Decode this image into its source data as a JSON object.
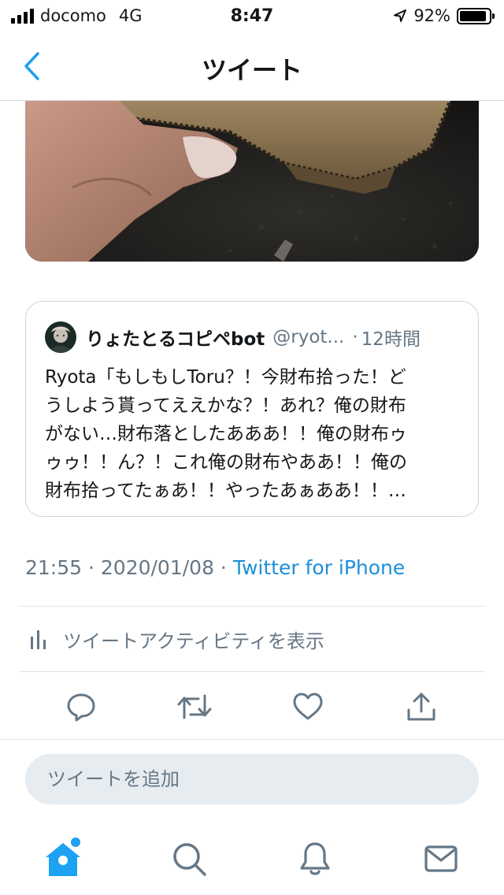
{
  "status_bar": {
    "carrier": "docomo",
    "network": "4G",
    "time": "8:47",
    "battery_text": "92%",
    "battery_level": 0.92
  },
  "nav": {
    "title": "ツイート",
    "back_icon": "chevron-left-icon"
  },
  "quoted_tweet": {
    "display_name": "りょたとるコピペbot",
    "handle": "@ryot...",
    "separator": "·",
    "time_ago": "12時間",
    "text_lines": [
      "Ryota「もしもしToru？！今財布拾った！ど",
      "うしよう貰ってええかな？！あれ？俺の財布",
      "がない…財布落としたあああ！！俺の財布ゥ",
      "ゥゥ！！ん？！これ俺の財布やああ！！俺の",
      "財布拾ってたぁあ！！やったあぁああ！！…"
    ]
  },
  "meta": {
    "timestamp": "21:55 · 2020/01/08 · ",
    "source": "Twitter for iPhone"
  },
  "activity": {
    "label": "ツイートアクティビティを表示",
    "icon": "bar-chart-icon"
  },
  "actions": [
    "reply-icon",
    "retweet-icon",
    "like-icon",
    "share-icon"
  ],
  "reply_input": {
    "placeholder": "ツイートを追加",
    "value": ""
  },
  "tab_bar": {
    "tabs": [
      "home-icon",
      "search-icon",
      "notifications-icon",
      "messages-icon"
    ],
    "active": "home-icon",
    "home_has_new_dot": true
  },
  "colors": {
    "accent": "#1da1f2",
    "link": "#1d8fd8",
    "secondary_text": "#657786",
    "icon_gray": "#657786",
    "divider": "#dfe3e7"
  }
}
